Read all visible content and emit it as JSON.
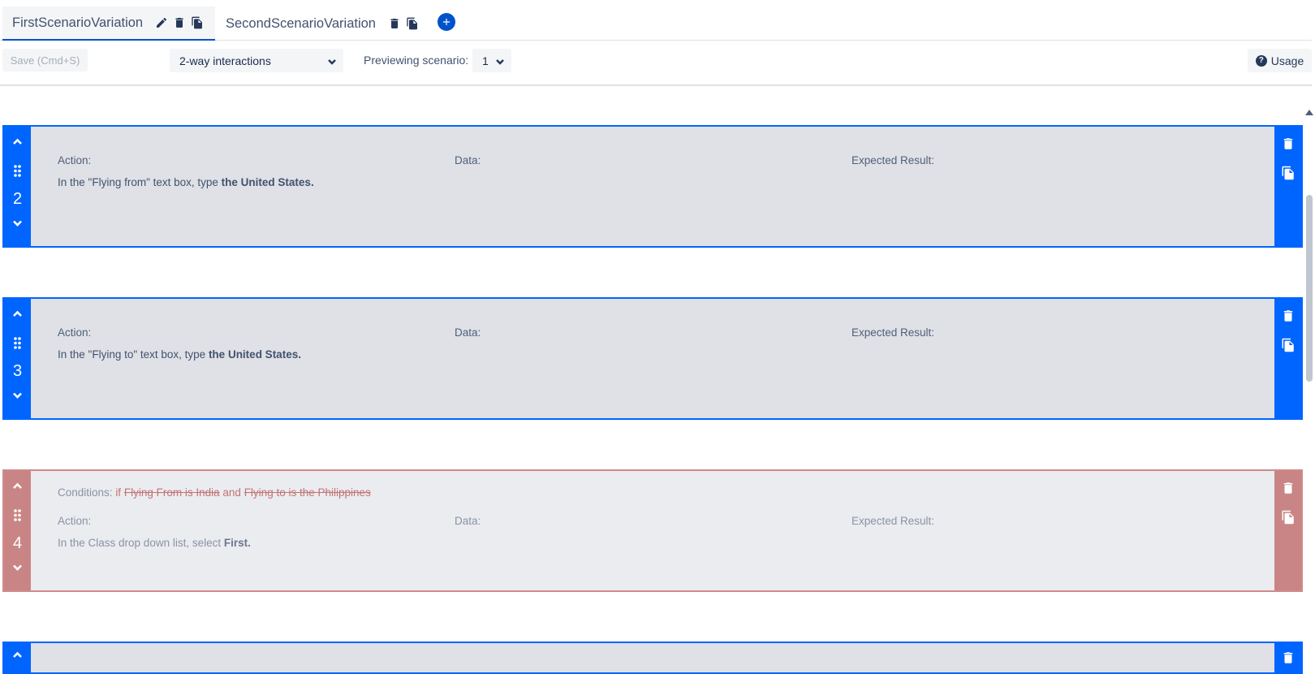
{
  "tabs": [
    {
      "label": "FirstScenarioVariation",
      "active": true
    },
    {
      "label": "SecondScenarioVariation",
      "active": false
    }
  ],
  "toolbar": {
    "save_label": "Save (Cmd+S)",
    "interactions_value": "2-way interactions",
    "preview_label": "Previewing scenario:",
    "scenario_value": "1",
    "usage_label": "Usage"
  },
  "steps": [
    {
      "number": "2",
      "action_label": "Action:",
      "data_label": "Data:",
      "expected_label": "Expected Result:",
      "action_prefix": "In the \"Flying from\" text box, type ",
      "action_bold": "the United States."
    },
    {
      "number": "3",
      "action_label": "Action:",
      "data_label": "Data:",
      "expected_label": "Expected Result:",
      "action_prefix": "In the \"Flying to\" text box, type ",
      "action_bold": "the United States."
    },
    {
      "number": "4",
      "conditions_label": "Conditions:",
      "cond_if": "if",
      "cond_first": "Flying From is India",
      "cond_and": "and",
      "cond_second": "Flying to is the Philippines",
      "action_label": "Action:",
      "data_label": "Data:",
      "expected_label": "Expected Result:",
      "action_prefix": "In the Class drop down list, select ",
      "action_bold": "First."
    }
  ],
  "colors": {
    "accent": "#0065ff",
    "disabled_step": "#c98585",
    "card_bg": "#dfe1e6"
  },
  "icons": [
    "pencil-icon",
    "trash-icon",
    "copy-icon",
    "plus-circle-icon",
    "chevron-down-icon",
    "chevron-up-icon",
    "grip-icon",
    "question-icon"
  ]
}
